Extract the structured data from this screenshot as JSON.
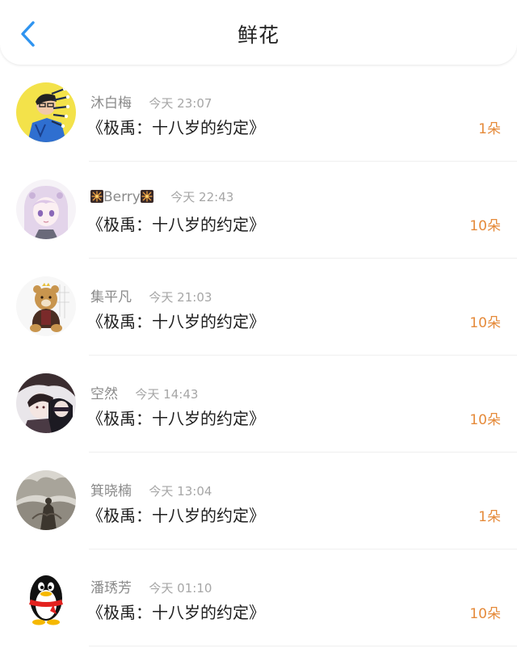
{
  "header": {
    "title": "鲜花",
    "back_icon": "chevron-left-icon",
    "accent_color": "#2f94f0"
  },
  "count_color": "#e58a3a",
  "entries": [
    {
      "name": "沐白梅",
      "time": "今天 23:07",
      "book": "《极禹：十八岁的约定》",
      "count": "1朵"
    },
    {
      "name_prefix_icon": "firework-icon",
      "name": "Berry",
      "name_suffix_icon": "firework-icon",
      "time": "今天 22:43",
      "book": "《极禹：十八岁的约定》",
      "count": "10朵"
    },
    {
      "name": "集平凡",
      "time": "今天 21:03",
      "book": "《极禹：十八岁的约定》",
      "count": "10朵"
    },
    {
      "name": "空然",
      "time": "今天 14:43",
      "book": "《极禹：十八岁的约定》",
      "count": "10朵"
    },
    {
      "name": "箕晓楠",
      "time": "今天 13:04",
      "book": "《极禹：十八岁的约定》",
      "count": "1朵"
    },
    {
      "name": "潘琇芳",
      "time": "今天 01:10",
      "book": "《极禹：十八岁的约定》",
      "count": "10朵"
    }
  ]
}
